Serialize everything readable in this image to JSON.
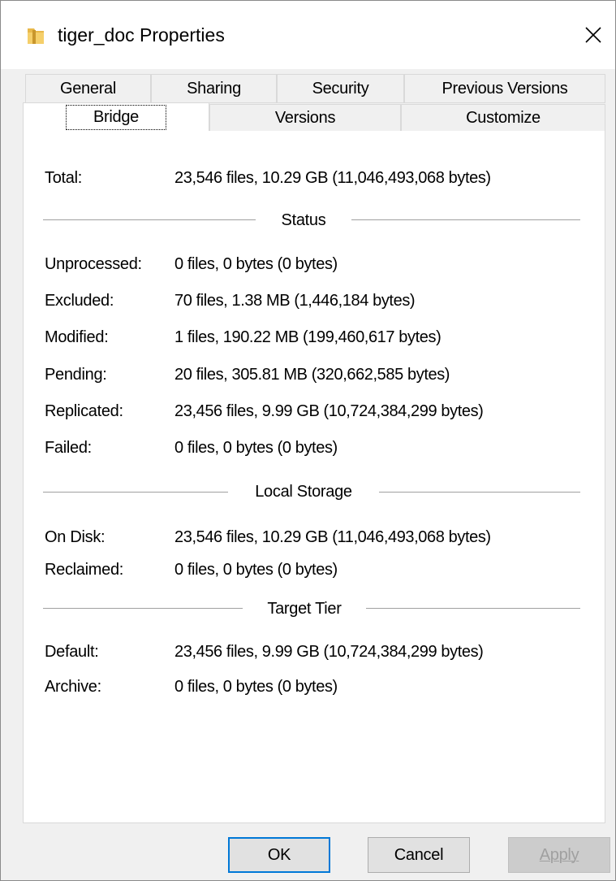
{
  "window": {
    "title": "tiger_doc Properties",
    "folder_icon": "folder-icon",
    "close_icon": "close-icon"
  },
  "tabs": {
    "row1": [
      "General",
      "Sharing",
      "Security",
      "Previous Versions"
    ],
    "row2": [
      "Bridge",
      "Versions",
      "Customize"
    ],
    "active": "Bridge"
  },
  "total": {
    "label": "Total:",
    "value": "23,546 files, 10.29 GB (11,046,493,068 bytes)"
  },
  "status": {
    "heading": "Status",
    "rows": [
      {
        "label": "Unprocessed:",
        "value": "0 files, 0 bytes (0 bytes)"
      },
      {
        "label": "Excluded:",
        "value": "70 files, 1.38 MB (1,446,184 bytes)"
      },
      {
        "label": "Modified:",
        "value": "1 files, 190.22 MB (199,460,617 bytes)"
      },
      {
        "label": "Pending:",
        "value": "20 files, 305.81 MB (320,662,585 bytes)"
      },
      {
        "label": "Replicated:",
        "value": "23,456 files, 9.99 GB (10,724,384,299 bytes)"
      },
      {
        "label": "Failed:",
        "value": "0 files, 0 bytes (0 bytes)"
      }
    ]
  },
  "local_storage": {
    "heading": "Local Storage",
    "rows": [
      {
        "label": "On Disk:",
        "value": "23,546 files, 10.29 GB (11,046,493,068 bytes)"
      },
      {
        "label": "Reclaimed:",
        "value": "0 files, 0 bytes (0 bytes)"
      }
    ]
  },
  "target_tier": {
    "heading": "Target Tier",
    "rows": [
      {
        "label": "Default:",
        "value": "23,456 files, 9.99 GB (10,724,384,299 bytes)"
      },
      {
        "label": "Archive:",
        "value": "0 files, 0 bytes (0 bytes)"
      }
    ]
  },
  "buttons": {
    "ok": "OK",
    "cancel": "Cancel",
    "apply": "Apply"
  },
  "colors": {
    "ok_border": "#0078d7",
    "folder": "#e8b84a",
    "disabled_text": "#a0a0a0"
  }
}
